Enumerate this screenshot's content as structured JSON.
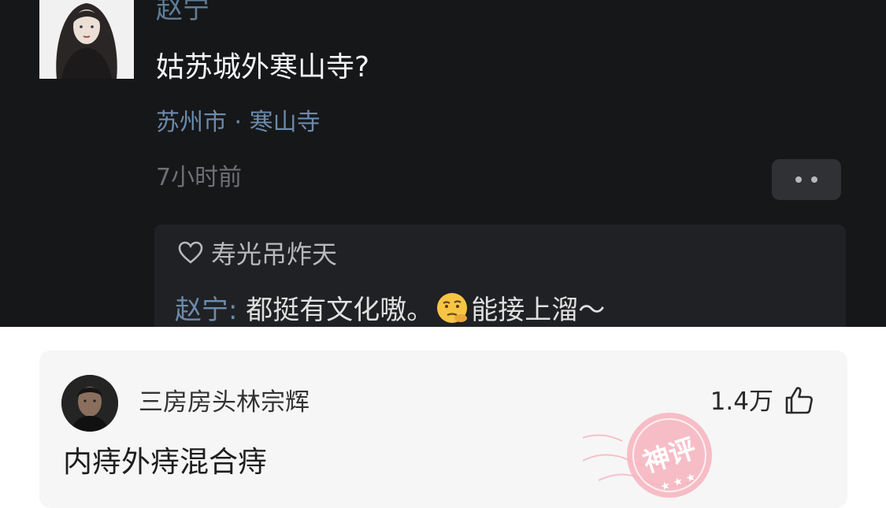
{
  "post": {
    "author": "赵宁",
    "text": "姑苏城外寒山寺?",
    "location": "苏州市 · 寒山寺",
    "time": "7小时前"
  },
  "reply_box": {
    "liked_by": "寿光吊炸天",
    "reply_author": "赵宁:",
    "reply_text_before": "都挺有文化嗷。",
    "reply_text_after": "能接上溜～",
    "emoji_icon": "thinking-emoji-icon"
  },
  "comment": {
    "author": "三房房头林宗辉",
    "likes": "1.4万",
    "text": "内痔外痔混合痔",
    "stamp_text": "神评",
    "stamp_color": "#f07a8a"
  },
  "colors": {
    "dark_bg": "#161719",
    "link_blue": "#6b8bad",
    "card_bg": "#f6f6f6"
  }
}
